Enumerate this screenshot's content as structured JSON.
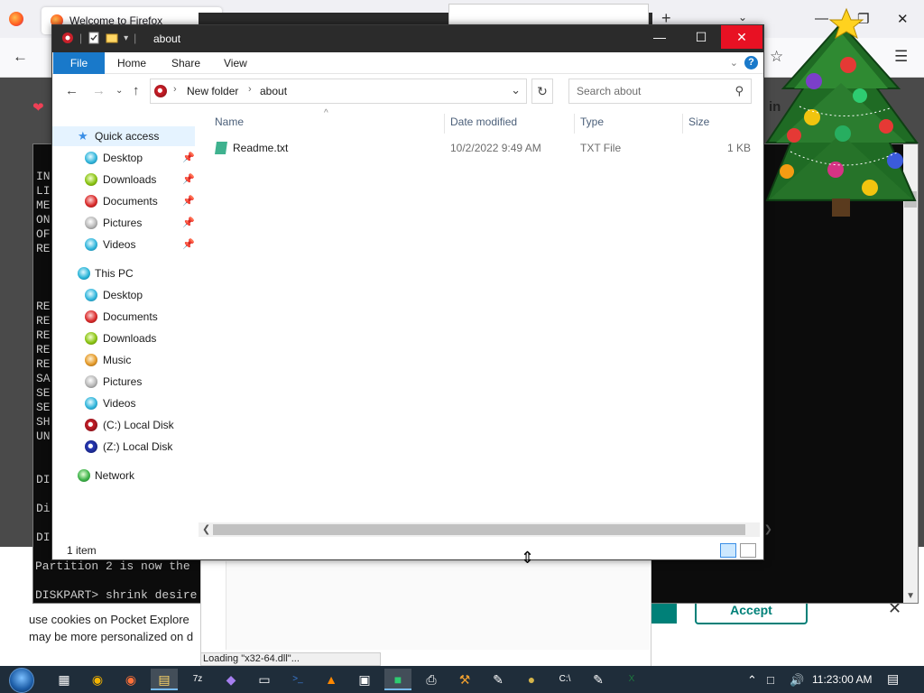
{
  "firefox": {
    "tab_title": "Welcome to Firefox",
    "in_text": "in",
    "cookie_line1": "use cookies on Pocket Explore",
    "cookie_line2": "may be more personalized on d",
    "accept": "Accept",
    "loading_status": "Loading \"x32-64.dll\"..."
  },
  "console": {
    "left_col_top": [
      "IN",
      "LI",
      "ME",
      "ON",
      "OF",
      "RE"
    ],
    "left_col_mid": [
      "RE",
      "RE",
      "RE",
      "RE",
      "RE",
      "SA",
      "SE",
      "SE",
      "SH",
      "UN"
    ],
    "di1": "DI",
    "di2": "Di",
    "di3": "DI",
    "line_partition": "Partition 2 is now the",
    "line_prompt": "DISKPART> shrink desire"
  },
  "explorer": {
    "title": "about",
    "ribbon_tabs": [
      "File",
      "Home",
      "Share",
      "View"
    ],
    "breadcrumb": [
      "New folder",
      "about"
    ],
    "search_placeholder": "Search about",
    "columns": [
      "Name",
      "Date modified",
      "Type",
      "Size"
    ],
    "files": [
      {
        "name": "Readme.txt",
        "date": "10/2/2022 9:49 AM",
        "type": "TXT File",
        "size": "1 KB"
      }
    ],
    "quick_access": {
      "label": "Quick access",
      "items": [
        "Desktop",
        "Downloads",
        "Documents",
        "Pictures",
        "Videos"
      ]
    },
    "this_pc": {
      "label": "This PC",
      "items": [
        "Desktop",
        "Documents",
        "Downloads",
        "Music",
        "Pictures",
        "Videos",
        "(C:) Local Disk",
        "(Z:) Local Disk"
      ]
    },
    "network": "Network",
    "status_count": "1 item"
  },
  "taskbar": {
    "apps": [
      "task-view",
      "chrome",
      "firefox",
      "file-explorer",
      "7zip",
      "visual-studio",
      "window",
      "powershell",
      "vlc",
      "screenshot",
      "app-green",
      "printer",
      "tools",
      "paint",
      "disc",
      "cmd",
      "notepad-plus",
      "excel"
    ],
    "clock": "11:23:00 AM"
  },
  "colors": {
    "accent": "#1979ca",
    "close_red": "#e81123",
    "title_dark": "#2b2b2b",
    "taskbar": "#1f2d3a",
    "pocket_teal": "#008078"
  }
}
